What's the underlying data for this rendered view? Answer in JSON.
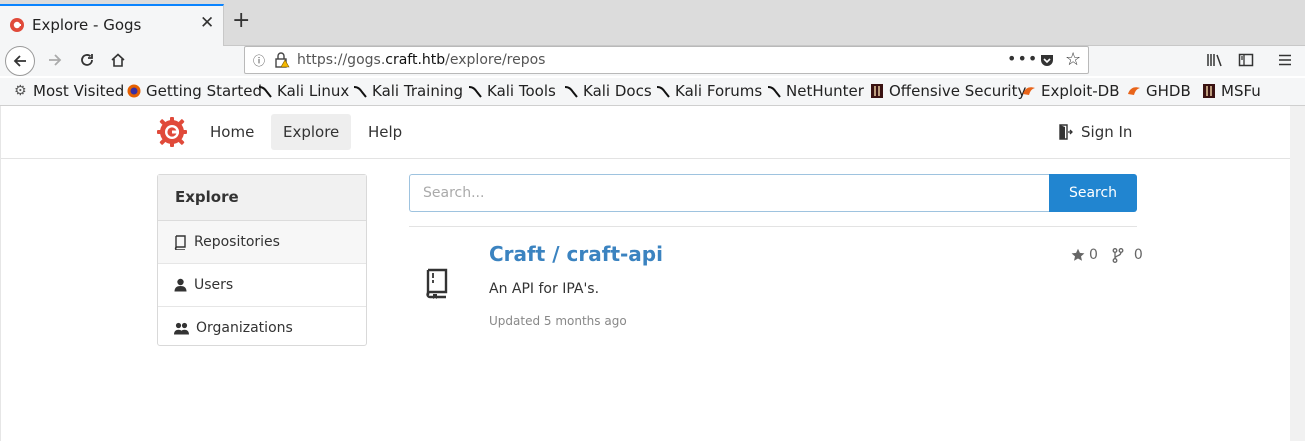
{
  "browser": {
    "tab_title": "Explore - Gogs",
    "tab_close": "✕",
    "new_tab": "+",
    "url_host_prefix": "https://gogs.",
    "url_host": "craft.htb",
    "url_path": "/explore/repos",
    "url_more": "•••",
    "bookmarks": [
      {
        "label": "Most Visited",
        "icon": "gear-icon"
      },
      {
        "label": "Getting Started",
        "icon": "firefox-icon"
      },
      {
        "label": "Kali Linux",
        "icon": "kali-icon"
      },
      {
        "label": "Kali Training",
        "icon": "kali-icon"
      },
      {
        "label": "Kali Tools",
        "icon": "kali-icon"
      },
      {
        "label": "Kali Docs",
        "icon": "kali-icon"
      },
      {
        "label": "Kali Forums",
        "icon": "kali-icon"
      },
      {
        "label": "NetHunter",
        "icon": "kali-icon"
      },
      {
        "label": "Offensive Security",
        "icon": "offsec-icon"
      },
      {
        "label": "Exploit-DB",
        "icon": "exploitdb-icon"
      },
      {
        "label": "GHDB",
        "icon": "exploitdb-icon"
      },
      {
        "label": "MSFu",
        "icon": "offsec-icon"
      }
    ]
  },
  "header": {
    "menu": {
      "home": "Home",
      "explore": "Explore",
      "help": "Help"
    },
    "sign_in": "Sign In"
  },
  "sidebar": {
    "title": "Explore",
    "items": [
      {
        "label": "Repositories",
        "icon": "repo-icon"
      },
      {
        "label": "Users",
        "icon": "user-icon"
      },
      {
        "label": "Organizations",
        "icon": "organization-icon"
      }
    ]
  },
  "search": {
    "placeholder": "Search...",
    "button": "Search"
  },
  "repo": {
    "name": "Craft / craft-api",
    "description": "An API for IPA's.",
    "updated": "Updated 5 months ago",
    "stars": "0",
    "forks": "0"
  },
  "colors": {
    "accent": "#2185d0",
    "repo_link": "#3b83c0",
    "logo": "#e04a3a"
  }
}
